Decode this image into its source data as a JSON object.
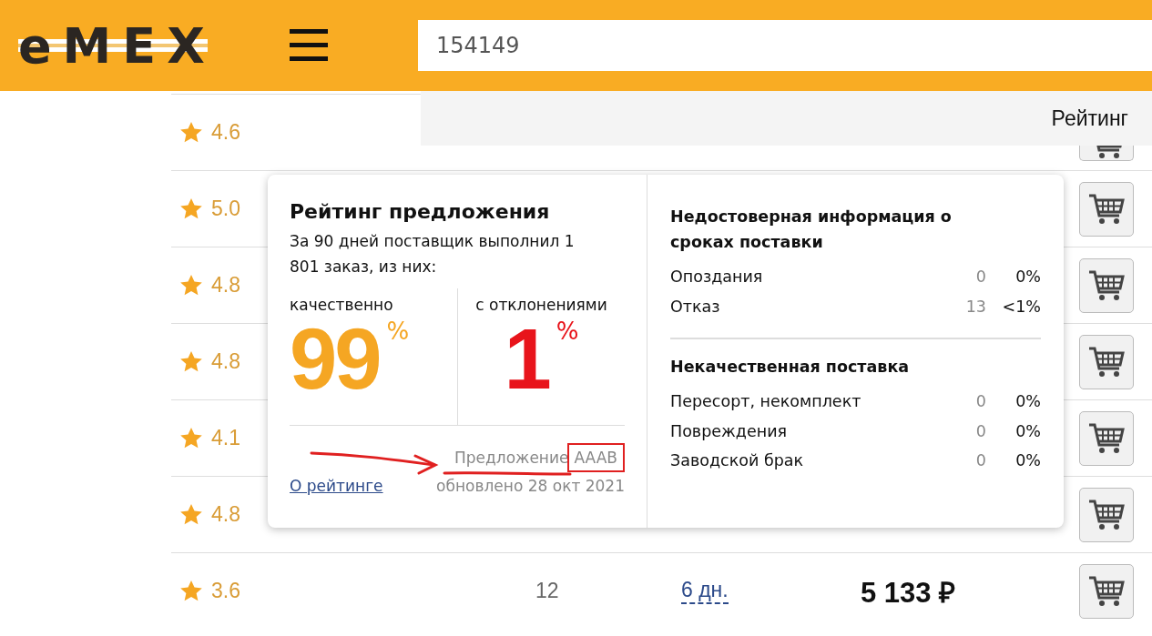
{
  "header": {
    "logo": "eMEX",
    "search": {
      "value": "154149"
    }
  },
  "sort_panel": {
    "label": "Рейтинг"
  },
  "rows": [
    {
      "rating": "4.6"
    },
    {
      "rating": "5.0"
    },
    {
      "rating": "4.8"
    },
    {
      "rating": "4.8"
    },
    {
      "rating": "4.1"
    },
    {
      "rating": "4.8"
    },
    {
      "rating": "3.6",
      "quantity": "12",
      "delivery": "6 дн.",
      "price": "5 133 ₽"
    }
  ],
  "popup": {
    "title": "Рейтинг предложения",
    "summary": "За 90 дней поставщик выполнил 1 801 заказ, из них:",
    "good": {
      "label": "качественно",
      "value": "99",
      "unit": "%"
    },
    "bad": {
      "label": "с отклонениями",
      "value": "1",
      "unit": "%"
    },
    "offer_label": "Предложение",
    "offer_class": "AAAB",
    "about_link": "О рейтинге",
    "updated": "обновлено 28 окт 2021",
    "sections": [
      {
        "title": "Недостоверная информация о сроках поставки",
        "items": [
          {
            "label": "Опоздания",
            "count": "0",
            "percent": "0%"
          },
          {
            "label": "Отказ",
            "count": "13",
            "percent": "<1%"
          }
        ]
      },
      {
        "title": "Некачественная поставка",
        "items": [
          {
            "label": "Пересорт, некомплект",
            "count": "0",
            "percent": "0%"
          },
          {
            "label": "Повреждения",
            "count": "0",
            "percent": "0%"
          },
          {
            "label": "Заводской брак",
            "count": "0",
            "percent": "0%"
          }
        ]
      }
    ]
  }
}
